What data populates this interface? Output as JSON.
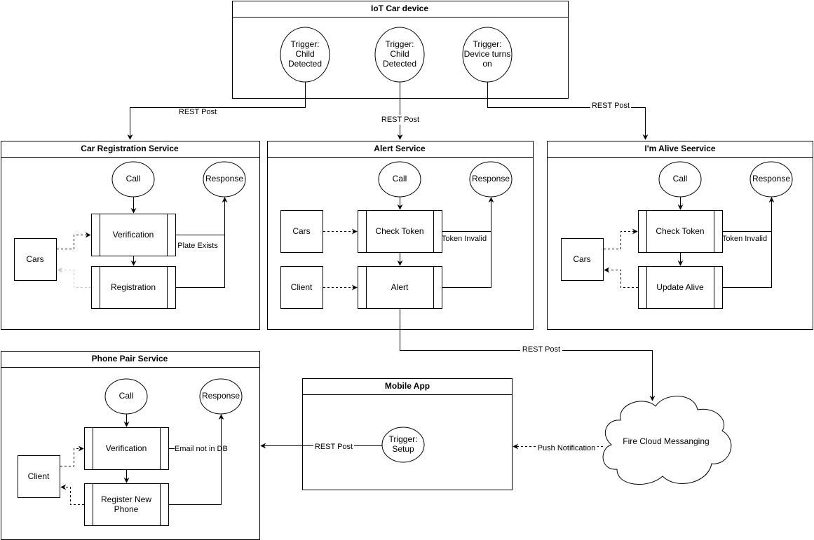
{
  "iot": {
    "title": "IoT Car device",
    "triggers": [
      [
        "Trigger:",
        "Child",
        "Detected"
      ],
      [
        "Trigger:",
        "Child",
        "Detected"
      ],
      [
        "Trigger:",
        "Device turns",
        "on"
      ]
    ]
  },
  "edges": {
    "rest1": "REST Post",
    "rest2": "REST Post",
    "rest3": "REST Post",
    "rest4": "REST Post",
    "rest5": "REST Post",
    "push": "Push Notification"
  },
  "car_reg": {
    "title": "Car Registration Service",
    "call": "Call",
    "response": "Response",
    "verification": "Verification",
    "registration": "Registration",
    "cars": "Cars",
    "plate_exists": "Plate Exists"
  },
  "alert": {
    "title": "Alert Service",
    "call": "Call",
    "response": "Response",
    "check_token": "Check Token",
    "alert": "Alert",
    "cars": "Cars",
    "client": "Client",
    "token_invalid": "Token Invalid"
  },
  "alive": {
    "title": "I'm Alive Seervice",
    "call": "Call",
    "response": "Response",
    "check_token": "Check Token",
    "update_alive": "Update Alive",
    "cars": "Cars",
    "token_invalid": "Token Invalid"
  },
  "phone": {
    "title": "Phone Pair Service",
    "call": "Call",
    "response": "Response",
    "verification": "Verification",
    "register": [
      "Register New",
      "Phone"
    ],
    "client": "Client",
    "email_not_in_db": "Email not in DB"
  },
  "mobile": {
    "title": "Mobile App",
    "trigger": [
      "Trigger:",
      "Setup"
    ]
  },
  "fcm": {
    "label": "Fire Cloud Messanging"
  }
}
